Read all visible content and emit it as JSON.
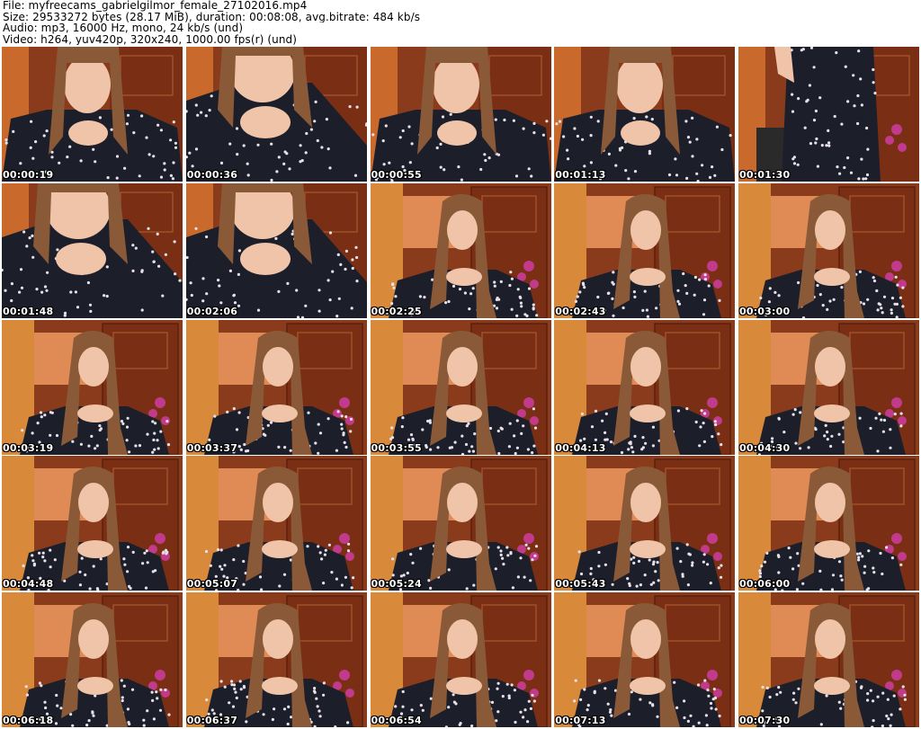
{
  "header": {
    "file": "File: myfreecams_gabrielgilmor_female_27102016.mp4",
    "size": "Size: 29533272 bytes (28.17 MiB), duration: 00:08:08, avg.bitrate: 484 kb/s",
    "audio": "Audio: mp3, 16000 Hz, mono, 24 kb/s (und)",
    "video": "Video: h264, yuv420p, 320x240, 1000.00 fps(r) (und)"
  },
  "thumbnails": [
    {
      "ts": "00:00:19",
      "scene": "close"
    },
    {
      "ts": "00:00:36",
      "scene": "lean"
    },
    {
      "ts": "00:00:55",
      "scene": "close"
    },
    {
      "ts": "00:01:13",
      "scene": "close"
    },
    {
      "ts": "00:01:30",
      "scene": "standing"
    },
    {
      "ts": "00:01:48",
      "scene": "lean"
    },
    {
      "ts": "00:02:06",
      "scene": "lean"
    },
    {
      "ts": "00:02:25",
      "scene": "seated"
    },
    {
      "ts": "00:02:43",
      "scene": "seated"
    },
    {
      "ts": "00:03:00",
      "scene": "seated"
    },
    {
      "ts": "00:03:19",
      "scene": "seated"
    },
    {
      "ts": "00:03:37",
      "scene": "seated"
    },
    {
      "ts": "00:03:55",
      "scene": "seated"
    },
    {
      "ts": "00:04:13",
      "scene": "seated"
    },
    {
      "ts": "00:04:30",
      "scene": "seated"
    },
    {
      "ts": "00:04:48",
      "scene": "seated"
    },
    {
      "ts": "00:05:07",
      "scene": "seated"
    },
    {
      "ts": "00:05:24",
      "scene": "seated"
    },
    {
      "ts": "00:05:43",
      "scene": "seated"
    },
    {
      "ts": "00:06:00",
      "scene": "seated"
    },
    {
      "ts": "00:06:18",
      "scene": "seated"
    },
    {
      "ts": "00:06:37",
      "scene": "seated"
    },
    {
      "ts": "00:06:54",
      "scene": "seated"
    },
    {
      "ts": "00:07:13",
      "scene": "seated"
    },
    {
      "ts": "00:07:30",
      "scene": "seated"
    }
  ],
  "colors": {
    "wall": "#8a3b1c",
    "wall_light": "#c96a2c",
    "door": "#d88a3a",
    "poster": "#e08a55",
    "dress": "#1c1f2a",
    "dots": "#e8e0ea",
    "skin": "#f0c4a8",
    "hair": "#8a5a38",
    "orchid": "#c23a8c",
    "chair": "#2a2a2a"
  }
}
